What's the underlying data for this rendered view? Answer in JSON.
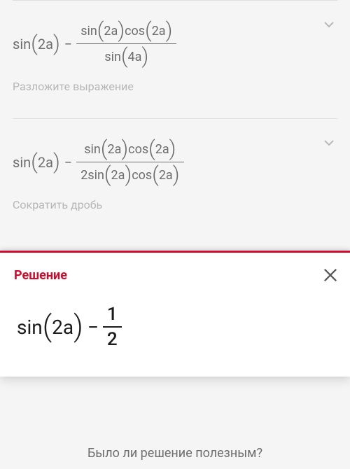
{
  "steps": [
    {
      "lhs": {
        "fn": "sin",
        "arg": "2a"
      },
      "op": "−",
      "rhs_num": [
        {
          "fn": "sin",
          "arg": "2a"
        },
        {
          "fn": "cos",
          "arg": "2a"
        }
      ],
      "rhs_den_coeff": "",
      "rhs_den": [
        {
          "fn": "sin",
          "arg": "4a"
        }
      ],
      "hint": "Разложите выражение"
    },
    {
      "lhs": {
        "fn": "sin",
        "arg": "2a"
      },
      "op": "−",
      "rhs_num": [
        {
          "fn": "sin",
          "arg": "2a"
        },
        {
          "fn": "cos",
          "arg": "2a"
        }
      ],
      "rhs_den_coeff": "2",
      "rhs_den": [
        {
          "fn": "sin",
          "arg": "2a"
        },
        {
          "fn": "cos",
          "arg": "2a"
        }
      ],
      "hint": "Сократить дробь"
    }
  ],
  "solution": {
    "title": "Решение",
    "lhs": {
      "fn": "sin",
      "arg": "2a"
    },
    "op": "−",
    "frac": {
      "num": "1",
      "den": "2"
    }
  },
  "feedback_prompt": "Было ли решение полезным?"
}
